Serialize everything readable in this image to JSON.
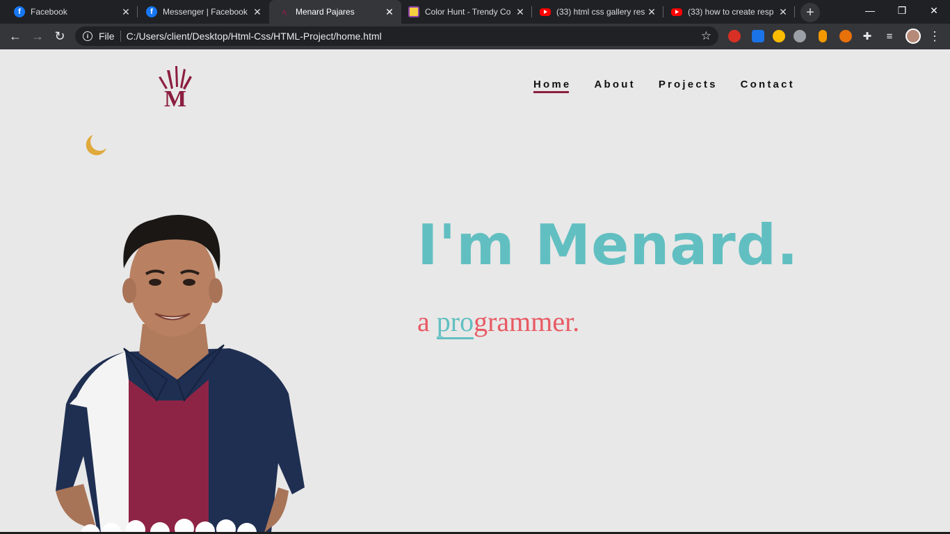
{
  "browser": {
    "tabs": [
      {
        "title": "Facebook",
        "icon": "facebook-icon"
      },
      {
        "title": "Messenger | Facebook",
        "icon": "facebook-icon"
      },
      {
        "title": "Menard Pajares",
        "icon": "menard-logo-icon",
        "active": true
      },
      {
        "title": "Color Hunt - Trendy Co",
        "icon": "color-hunt-icon"
      },
      {
        "title": "(33) html css gallery res",
        "icon": "youtube-icon"
      },
      {
        "title": "(33) how to create resp",
        "icon": "youtube-icon"
      }
    ],
    "new_tab_label": "+",
    "omnibox": {
      "scheme": "File",
      "url": "C:/Users/client/Desktop/Html-Css/HTML-Project/home.html"
    },
    "colors": {
      "frame": "#202124",
      "toolbar": "#35363a"
    }
  },
  "site": {
    "nav": [
      {
        "label": "Home",
        "active": true
      },
      {
        "label": "About"
      },
      {
        "label": "Projects"
      },
      {
        "label": "Contact"
      }
    ],
    "logo_letter": "M",
    "hero": {
      "title": "I'm Menard.",
      "subtitle_prefix": "a",
      "subtitle_typed": "pro",
      "subtitle_rest": "grammer."
    },
    "colors": {
      "background": "#e8e8e8",
      "accent": "#8b1e3f",
      "teal": "#62bfc1",
      "coral": "#e85a64",
      "moon": "#e0a93b"
    }
  }
}
